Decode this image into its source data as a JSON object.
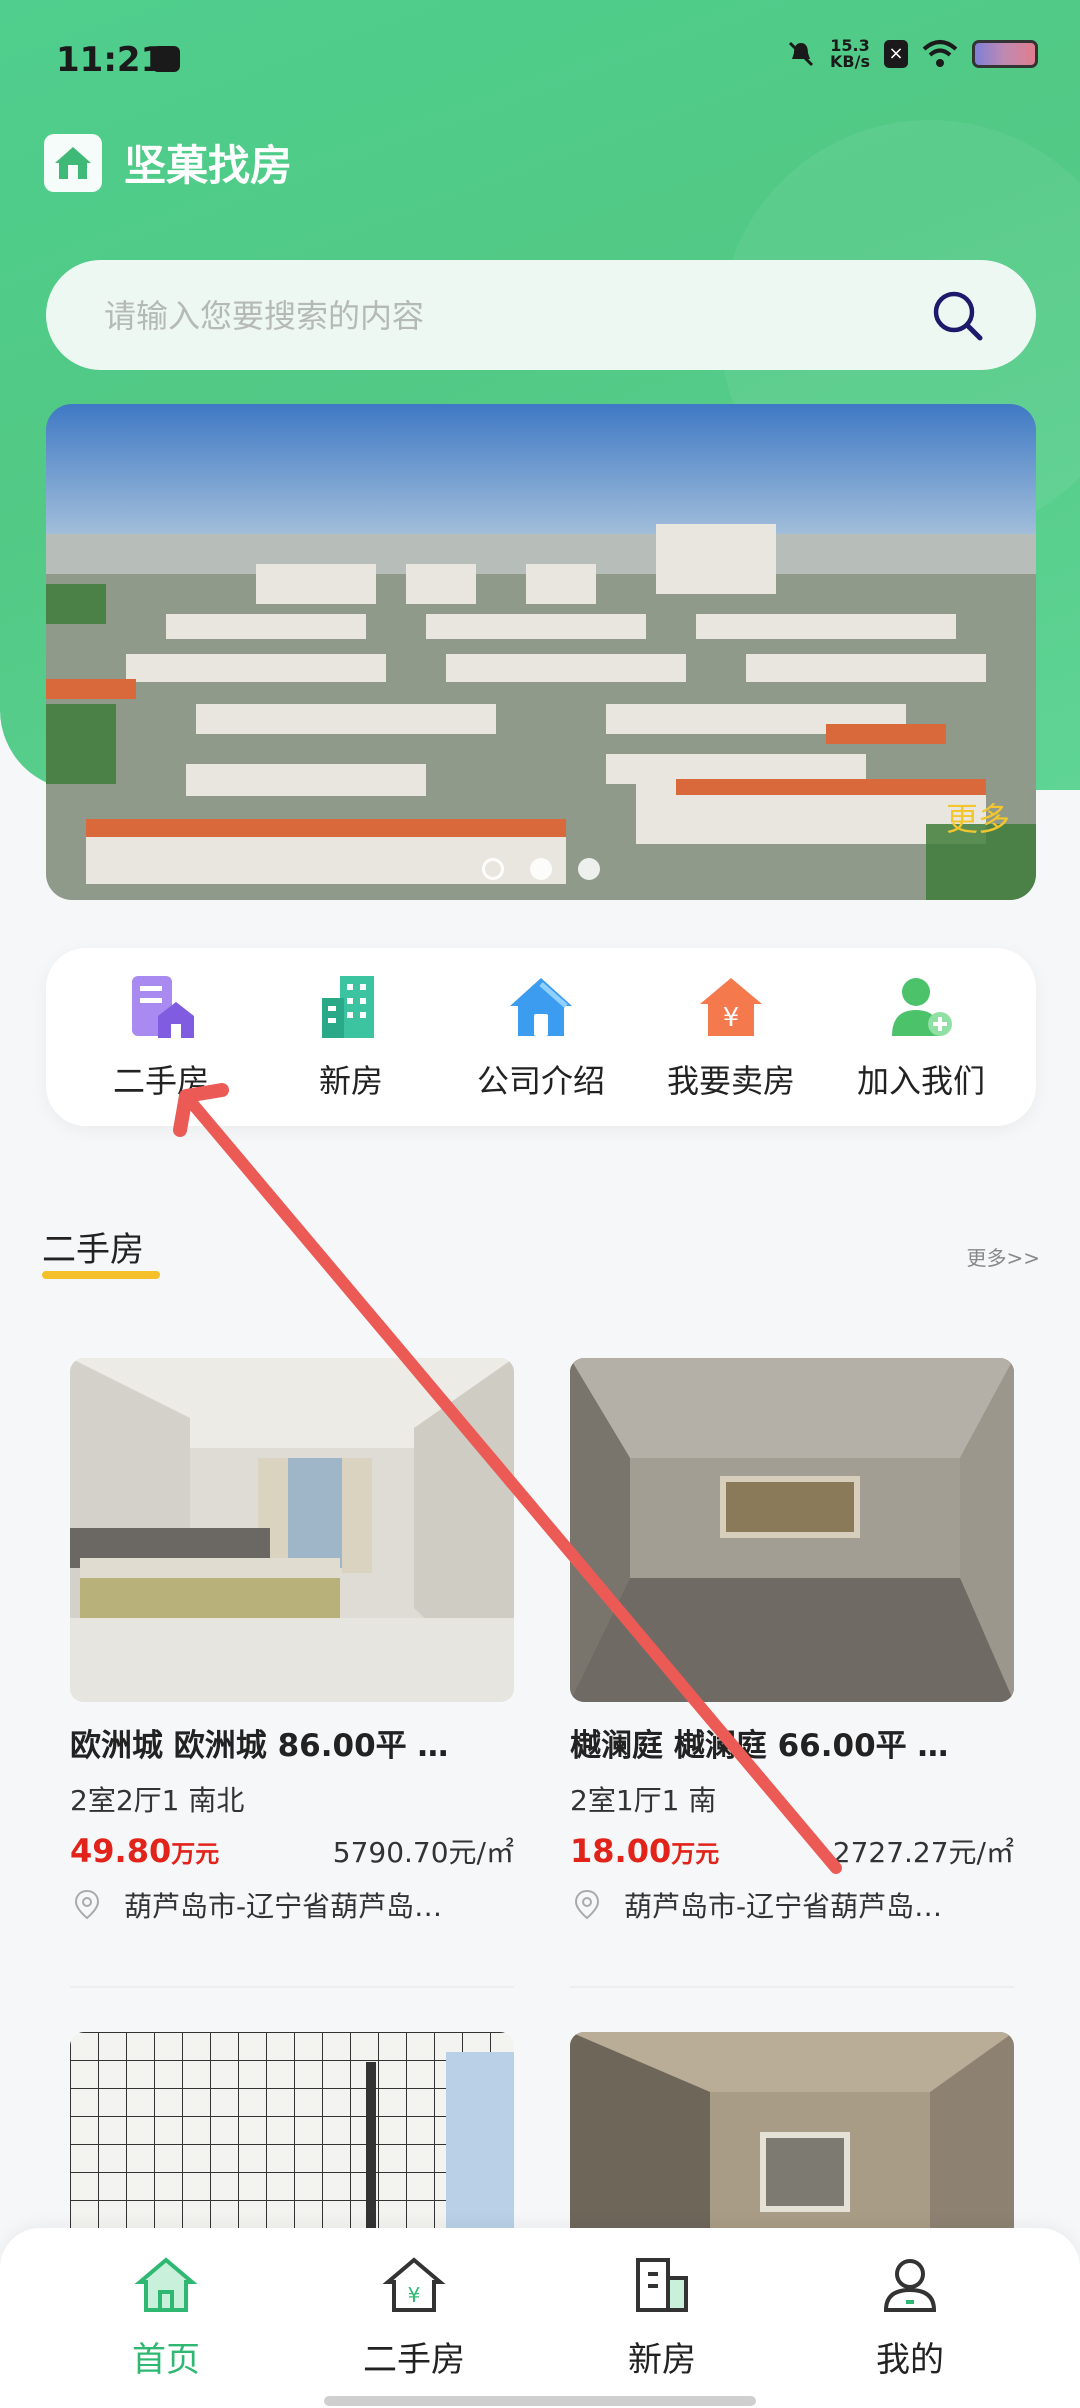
{
  "status_bar": {
    "time": "11:21",
    "net_speed_top": "15.3",
    "net_speed_bottom": "KB/s"
  },
  "app": {
    "title": "坚菓找房"
  },
  "search": {
    "placeholder": "请输入您要搜索的内容"
  },
  "banner": {
    "more": "更多",
    "slide_count": 3,
    "active_slide": 1
  },
  "nav": {
    "items": [
      {
        "label": "二手房",
        "icon": "second-hand-house-icon"
      },
      {
        "label": "新房",
        "icon": "new-house-building-icon"
      },
      {
        "label": "公司介绍",
        "icon": "company-house-icon"
      },
      {
        "label": "我要卖房",
        "icon": "sell-house-yen-icon"
      },
      {
        "label": "加入我们",
        "icon": "join-user-plus-icon"
      }
    ]
  },
  "section": {
    "title": "二手房",
    "more": "更多>>"
  },
  "listings": [
    {
      "title": "欧洲城 欧洲城 86.00平 …",
      "layout": "2室2厅1 南北",
      "price": "49.80",
      "price_unit": "万元",
      "unit_price": "5790.70元/㎡",
      "address": "葫芦岛市-辽宁省葫芦岛…"
    },
    {
      "title": "樾澜庭 樾澜庭 66.00平 …",
      "layout": "2室1厅1 南",
      "price": "18.00",
      "price_unit": "万元",
      "unit_price": "2727.27元/㎡",
      "address": "葫芦岛市-辽宁省葫芦岛…"
    }
  ],
  "tabbar": {
    "items": [
      {
        "label": "首页",
        "icon": "home-icon",
        "active": true
      },
      {
        "label": "二手房",
        "icon": "second-hand-house-icon"
      },
      {
        "label": "新房",
        "icon": "new-house-building-icon"
      },
      {
        "label": "我的",
        "icon": "user-profile-icon"
      }
    ]
  },
  "colors": {
    "brand_green": "#4fce8d",
    "price_red": "#e2231a",
    "accent_yellow": "#f6c02b",
    "annotation_arrow": "#ec5a55"
  }
}
